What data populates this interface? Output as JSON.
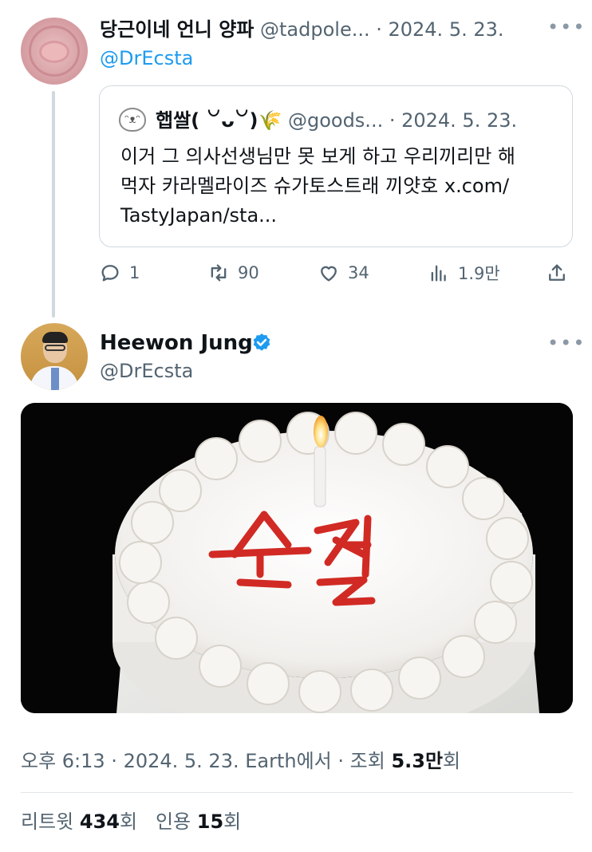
{
  "parent_tweet": {
    "display_name": "당근이네 언니 양파",
    "handle_date": "@tadpole... · 2024. 5. 23.",
    "reply_to": "@DrEcsta",
    "more_icon": "more-horizontal-icon",
    "quoted": {
      "display_name": "햅쌀( ꒡ᴗ꒡)🌾",
      "handle_date": "@goods... · 2024. 5. 23.",
      "text_line1": "이거 그 의사선생님만 못 보게 하고 우리끼리만 해",
      "text_line2": "먹자 카라멜라이즈 슈가토스트래 끼얏호 x.com/",
      "text_line3": "TastyJapan/sta..."
    },
    "actions": {
      "replies": "1",
      "retweets": "90",
      "likes": "34",
      "views": "1.9만"
    }
  },
  "main_tweet": {
    "display_name": "Heewon Jung",
    "handle": "@DrEcsta",
    "verified_color": "#1d9bf0",
    "image_text": "손절",
    "meta_prefix": "오후 6:13 · 2024. 5. 23. Earth에서 · 조회 ",
    "views_value": "5.3만",
    "views_suffix": "회",
    "retweets_label": "리트윗 ",
    "retweets_value": "434",
    "retweets_suffix": "회",
    "quotes_label": "인용 ",
    "quotes_value": "15",
    "quotes_suffix": "회"
  }
}
